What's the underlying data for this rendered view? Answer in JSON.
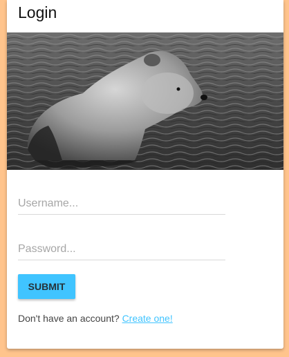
{
  "page": {
    "title": "Login"
  },
  "hero": {
    "image": "bear-in-water-photo"
  },
  "form": {
    "username_placeholder": "Username...",
    "password_placeholder": "Password...",
    "submit_label": "SUBMIT"
  },
  "signup": {
    "prompt": "Don't have an account?",
    "link_label": "Create one!"
  },
  "colors": {
    "background": "#FFC48C",
    "accent": "#40C4FF",
    "card": "#FFFFFF"
  }
}
